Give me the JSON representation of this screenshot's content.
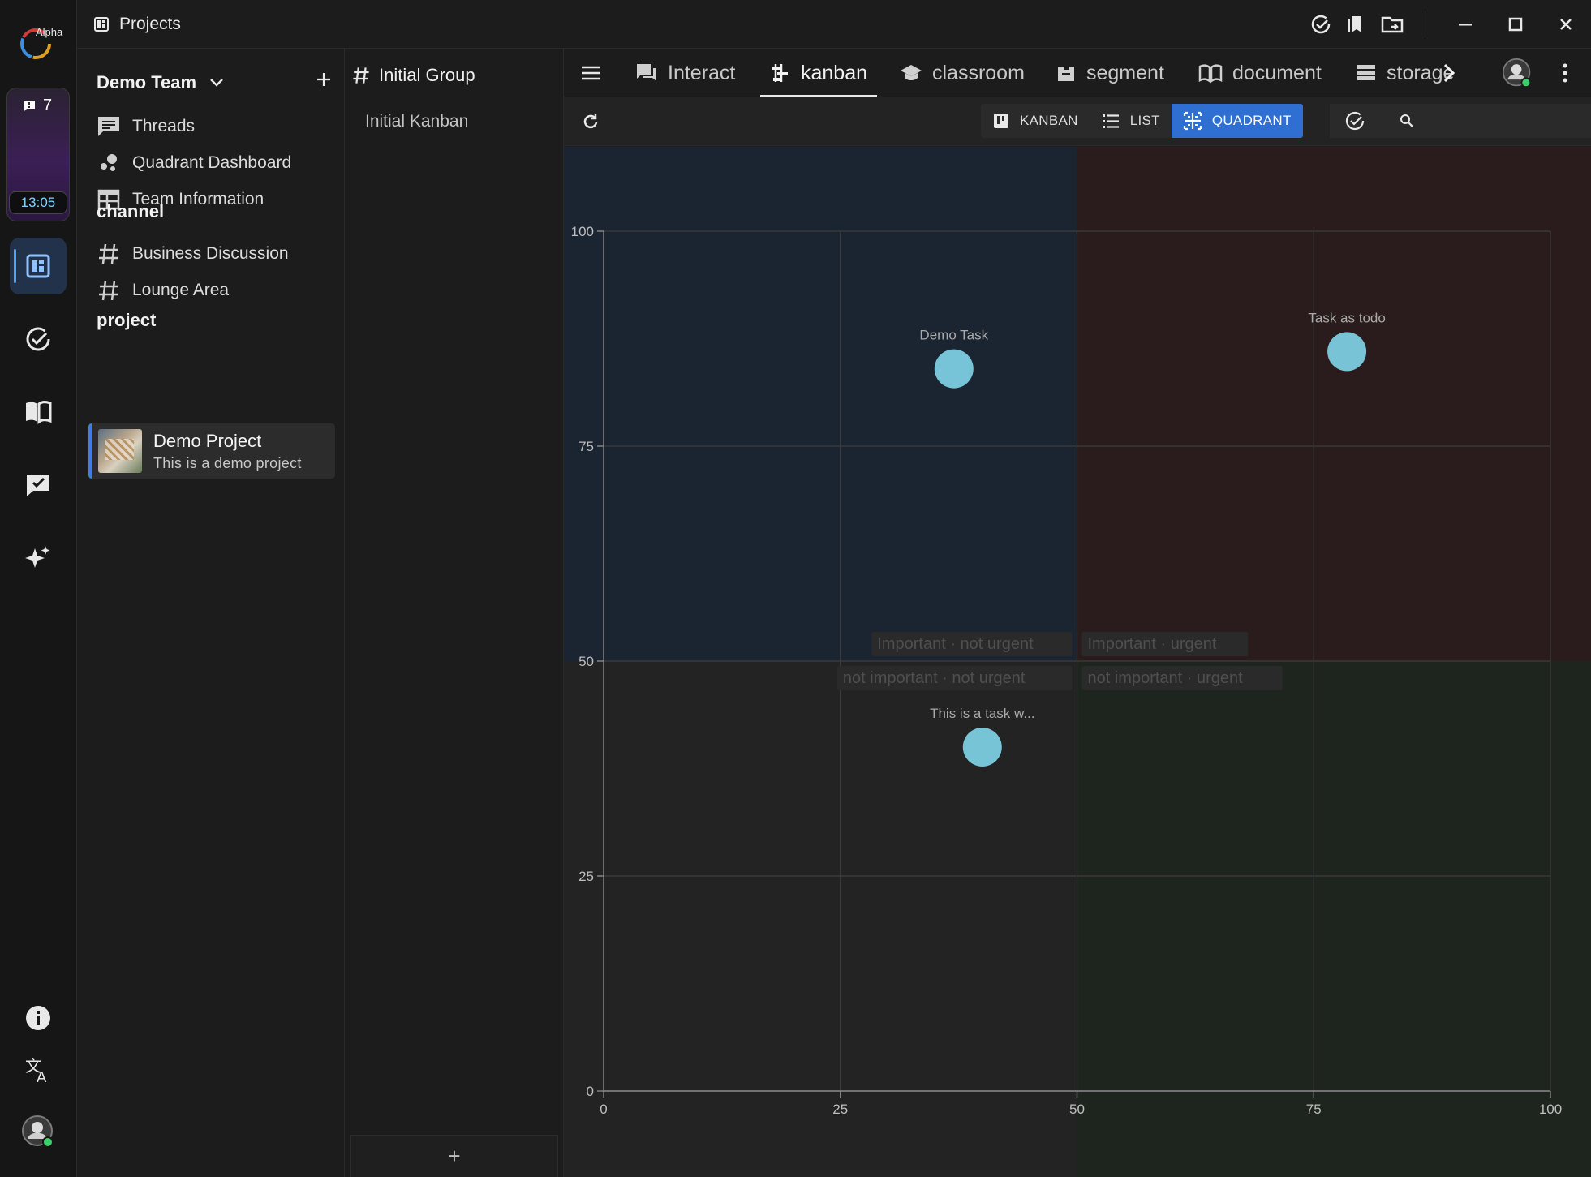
{
  "titlebar": {
    "title": "Projects"
  },
  "rail": {
    "logo_text": "Alpha",
    "notification_count": "7",
    "clock": "13:05",
    "items": [
      {
        "name": "projects",
        "active": true
      },
      {
        "name": "tasks",
        "active": false
      },
      {
        "name": "docs",
        "active": false
      },
      {
        "name": "chat-check",
        "active": false
      },
      {
        "name": "ai",
        "active": false
      }
    ]
  },
  "sidebar": {
    "team_name": "Demo Team",
    "items": [
      {
        "label": "Threads"
      },
      {
        "label": "Quadrant Dashboard"
      },
      {
        "label": "Team Information"
      }
    ],
    "channel_title": "channel",
    "channels": [
      {
        "label": "Business Discussion"
      },
      {
        "label": "Lounge Area"
      }
    ],
    "project_title": "project",
    "project": {
      "title": "Demo Project",
      "description": "This is a demo project"
    }
  },
  "group": {
    "title": "Initial Group",
    "kanban": "Initial Kanban",
    "add_label": "+"
  },
  "tabs": [
    {
      "label": "Interact"
    },
    {
      "label": "kanban"
    },
    {
      "label": "classroom"
    },
    {
      "label": "segment"
    },
    {
      "label": "document"
    },
    {
      "label": "storage"
    }
  ],
  "views": {
    "kanban": "KANBAN",
    "list": "LIST",
    "quadrant": "QUADRANT"
  },
  "colors": {
    "q_important_not_urgent": "#1b2431",
    "q_important_urgent": "#2a1c1c",
    "q_not_important_not_urgent": "#232323",
    "q_not_important_urgent": "#1e251f",
    "point": "#7fd3e6",
    "accent": "#2f6fd1"
  },
  "chart_data": {
    "type": "scatter",
    "xlim": [
      0,
      100
    ],
    "ylim": [
      0,
      100
    ],
    "xticks": [
      0,
      25,
      50,
      75,
      100
    ],
    "yticks": [
      0,
      25,
      50,
      75,
      100
    ],
    "grid": true,
    "quadrant_labels": {
      "top_left": "Important · not urgent",
      "top_right": "Important · urgent",
      "bottom_left": "not important · not urgent",
      "bottom_right": "not important · urgent"
    },
    "points": [
      {
        "label": "Demo Task",
        "x": 37,
        "y": 84
      },
      {
        "label": "Task as todo",
        "x": 78.5,
        "y": 86
      },
      {
        "label": "This is a task w...",
        "x": 40,
        "y": 40
      }
    ]
  }
}
